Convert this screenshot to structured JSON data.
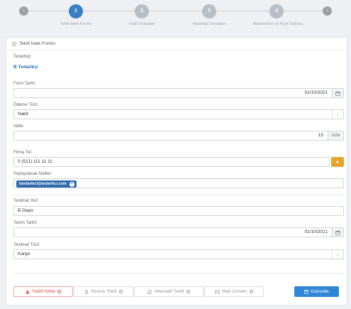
{
  "wizard": {
    "steps": [
      {
        "number": "1",
        "label": "Teklif İstek Formu",
        "active": true
      },
      {
        "number": "2",
        "label": "Teklif Dosyaları",
        "active": false
      },
      {
        "number": "3",
        "label": "Tedarikçi Cevapları",
        "active": false
      },
      {
        "number": "4",
        "label": "Malzemeler ve Fiyat Tablosu",
        "active": false
      }
    ],
    "prev_icon": "‹",
    "next_icon": "›"
  },
  "card": {
    "title": "Teklif İstek Formu",
    "header_icon": "info-icon"
  },
  "form": {
    "supplier_label": "Tedarikçi:",
    "supplier_value": "B Tedarikçi",
    "form_date_label": "Form Tarihi:",
    "form_date_value": "01/10/2021",
    "payment_type_label": "Ödeme Türü:",
    "payment_type_value": "Nakit",
    "term_label": "Vade:",
    "term_value": "15",
    "term_unit": "GÜN",
    "company_phone_label": "Firma Tel:",
    "company_phone_value": "0 (511) 111 11 11",
    "shared_mails_label": "Paylaşılacak Mailler:",
    "shared_mails": [
      "btedarikci@tedarikci.com"
    ],
    "delivery_place_label": "Teslimat Yeri:",
    "delivery_place_value": "B Depo",
    "supply_date_label": "Temin Tarihi:",
    "supply_date_value": "01/10/2021",
    "delivery_type_label": "Teslimat Türü:",
    "delivery_type_value": "Kargo"
  },
  "actions": {
    "lock_label": "Teklifi Kilitle",
    "revise_label": "Revize Teklif",
    "alternative_label": "Alternatif Teklif",
    "mail_label": "Mail Gönder",
    "update_label": "Güncelle"
  },
  "colors": {
    "accent": "#3a7fc1",
    "warning": "#e3a52c",
    "danger": "#d9534f",
    "primary": "#2f86d6"
  }
}
